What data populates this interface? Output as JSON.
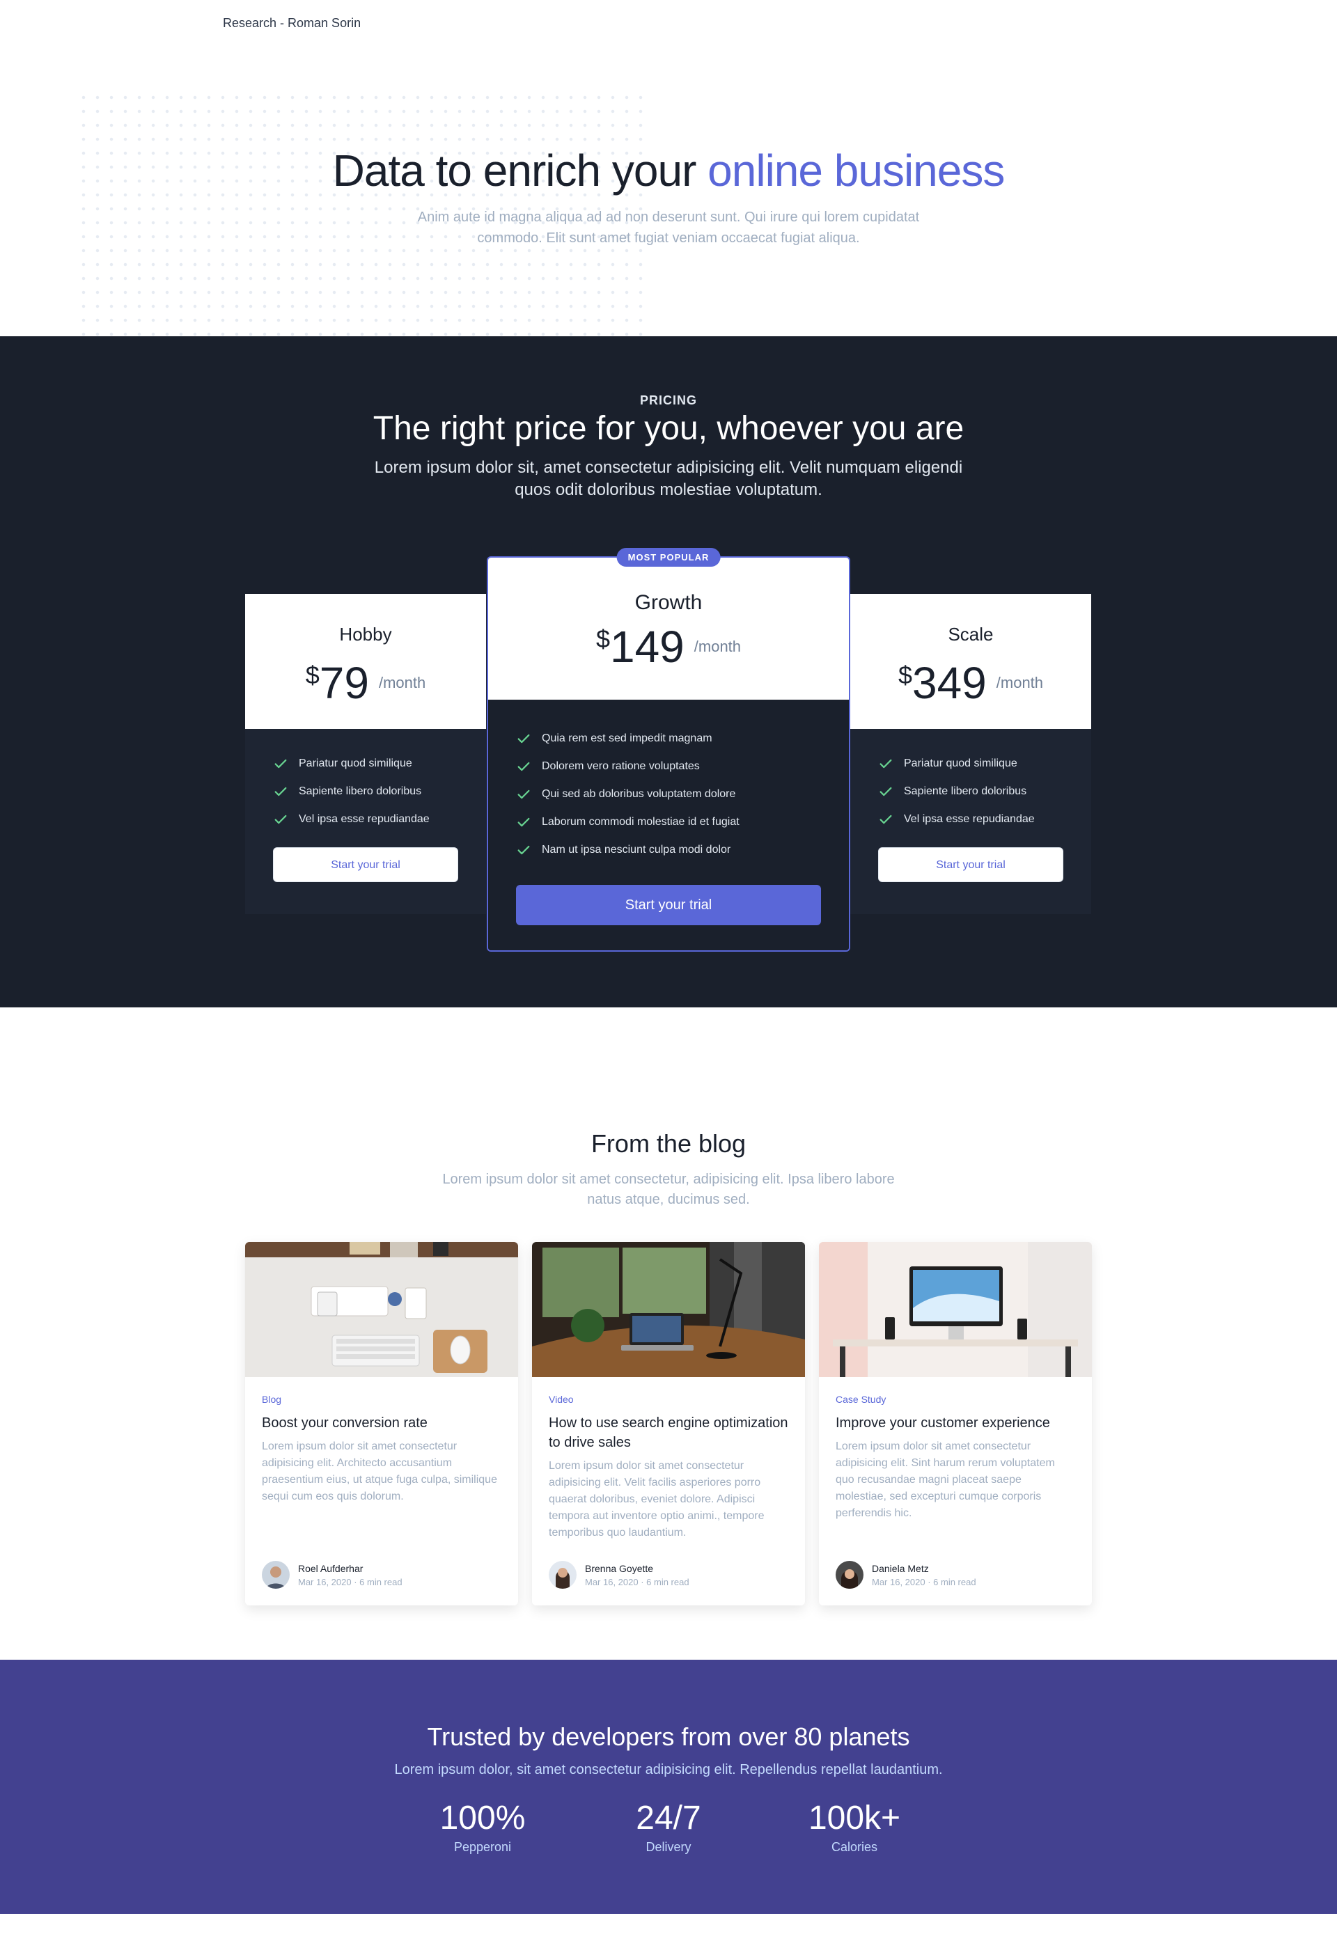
{
  "breadcrumb": "Research - Roman Sorin",
  "hero": {
    "title_prefix": "Data to enrich your ",
    "title_accent": "online business",
    "subtitle": "Anim aute id magna aliqua ad ad non deserunt sunt. Qui irure qui lorem cupidatat commodo. Elit sunt amet fugiat veniam occaecat fugiat aliqua."
  },
  "pricing": {
    "eyebrow": "PRICING",
    "title": "The right price for you, whoever you are",
    "subtitle": "Lorem ipsum dolor sit, amet consectetur adipisicing elit. Velit numquam eligendi quos odit doloribus molestiae voluptatum.",
    "plans": [
      {
        "name": "Hobby",
        "currency": "$",
        "amount": "79",
        "period": "/month",
        "features": [
          "Pariatur quod similique",
          "Sapiente libero doloribus",
          "Vel ipsa esse repudiandae"
        ],
        "cta": "Start your trial"
      },
      {
        "name": "Growth",
        "currency": "$",
        "amount": "149",
        "period": "/month",
        "badge": "MOST POPULAR",
        "features": [
          "Quia rem est sed impedit magnam",
          "Dolorem vero ratione voluptates",
          "Qui sed ab doloribus voluptatem dolore",
          "Laborum commodi molestiae id et fugiat",
          "Nam ut ipsa nesciunt culpa modi dolor"
        ],
        "cta": "Start your trial"
      },
      {
        "name": "Scale",
        "currency": "$",
        "amount": "349",
        "period": "/month",
        "features": [
          "Pariatur quod similique",
          "Sapiente libero doloribus",
          "Vel ipsa esse repudiandae"
        ],
        "cta": "Start your trial"
      }
    ]
  },
  "blog": {
    "title": "From the blog",
    "subtitle": "Lorem ipsum dolor sit amet consectetur, adipisicing elit. Ipsa libero labore natus atque, ducimus sed.",
    "posts": [
      {
        "category": "Blog",
        "title": "Boost your conversion rate",
        "excerpt": "Lorem ipsum dolor sit amet consectetur adipisicing elit. Architecto accusantium praesentium eius, ut atque fuga culpa, similique sequi cum eos quis dolorum.",
        "author": "Roel Aufderhar",
        "meta": "Mar 16, 2020 · 6 min read"
      },
      {
        "category": "Video",
        "title": "How to use search engine optimization to drive sales",
        "excerpt": "Lorem ipsum dolor sit amet consectetur adipisicing elit. Velit facilis asperiores porro quaerat doloribus, eveniet dolore. Adipisci tempora aut inventore optio animi., tempore temporibus quo laudantium.",
        "author": "Brenna Goyette",
        "meta": "Mar 16, 2020 · 6 min read"
      },
      {
        "category": "Case Study",
        "title": "Improve your customer experience",
        "excerpt": "Lorem ipsum dolor sit amet consectetur adipisicing elit. Sint harum rerum voluptatem quo recusandae magni placeat saepe molestiae, sed excepturi cumque corporis perferendis hic.",
        "author": "Daniela Metz",
        "meta": "Mar 16, 2020 · 6 min read"
      }
    ]
  },
  "stats": {
    "title": "Trusted by developers from over 80 planets",
    "subtitle": "Lorem ipsum dolor, sit amet consectetur adipisicing elit. Repellendus repellat laudantium.",
    "items": [
      {
        "value": "100%",
        "label": "Pepperoni"
      },
      {
        "value": "24/7",
        "label": "Delivery"
      },
      {
        "value": "100k+",
        "label": "Calories"
      }
    ]
  },
  "colors": {
    "accent": "#5a67d8",
    "dark": "#1a202c",
    "stats_bg": "#434190",
    "check": "#68d391"
  },
  "icons": [
    "check-icon"
  ]
}
